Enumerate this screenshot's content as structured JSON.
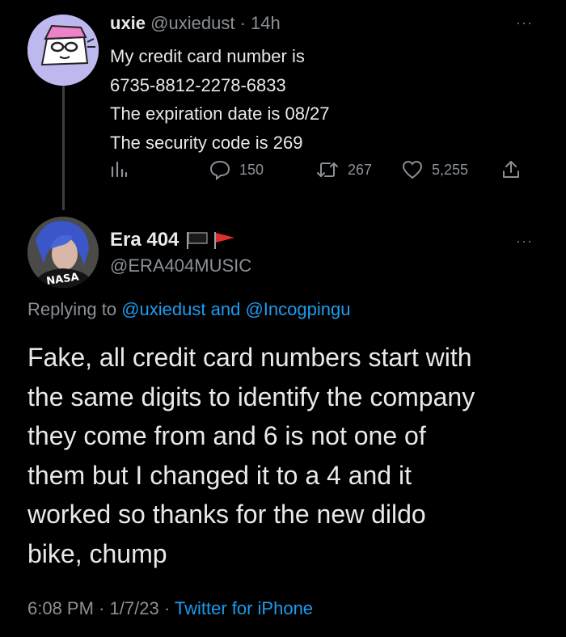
{
  "tweet": {
    "name": "uxie",
    "handle": "@uxiedust",
    "separator": "·",
    "time": "14h",
    "lines": [
      "My credit card number is",
      "6735-8812-2278-6833",
      "The expiration date is 08/27",
      "The security code is 269"
    ],
    "stats": {
      "views_icon": "analytics-icon",
      "replies": "150",
      "retweets": "267",
      "likes": "5,255"
    },
    "more_label": "···"
  },
  "reply": {
    "name": "Era 404",
    "handle": "@ERA404MUSIC",
    "more_label": "···",
    "replying_prefix": "Replying to",
    "replying_user1": "@uxiedust",
    "replying_and": "and",
    "replying_user2": "@Incogpingu",
    "lines": [
      "Fake, all credit card numbers start with",
      "the same digits to identify the company",
      "they come from and 6 is not one of",
      "them but I changed it to a 4 and it",
      "worked so thanks for the new dildo",
      "bike, chump"
    ],
    "time": "6:08 PM",
    "sep1": "·",
    "date": "1/7/23",
    "sep2": "·",
    "source": "Twitter for iPhone",
    "avatar_shirt_text": "NASA"
  },
  "colors": {
    "background": "#000000",
    "text": "#e7e9ea",
    "secondary": "#8b9096",
    "link": "#1d9bf0",
    "avatar_bg": "#bdb8ee"
  }
}
